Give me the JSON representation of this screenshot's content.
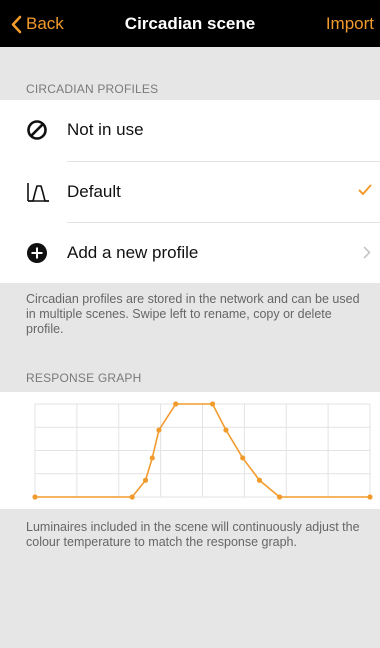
{
  "navbar": {
    "back_label": "Back",
    "title": "Circadian scene",
    "import_label": "Import",
    "accent": "#f29b2d"
  },
  "profiles": {
    "header": "CIRCADIAN PROFILES",
    "items": [
      {
        "label": "Not in use",
        "icon": "not-in-use-icon",
        "selected": false
      },
      {
        "label": "Default",
        "icon": "curve-icon",
        "selected": true
      },
      {
        "label": "Add a new profile",
        "icon": "plus-circle-icon",
        "selected": false
      }
    ],
    "footnote": "Circadian profiles are stored in the network and can be used in multiple scenes. Swipe left to rename, copy or delete profile."
  },
  "graph": {
    "header": "RESPONSE GRAPH",
    "footnote": "Luminaires included in the scene will continuously adjust the colour temperature to match the response graph.",
    "line_color": "#f29b2d",
    "grid_color": "#e3e3e3",
    "x_range": [
      0,
      1
    ],
    "y_range": [
      0,
      1
    ],
    "points": [
      [
        0.0,
        0.0
      ],
      [
        0.29,
        0.0
      ],
      [
        0.33,
        0.18
      ],
      [
        0.35,
        0.42
      ],
      [
        0.37,
        0.72
      ],
      [
        0.42,
        1.0
      ],
      [
        0.53,
        1.0
      ],
      [
        0.57,
        0.72
      ],
      [
        0.62,
        0.42
      ],
      [
        0.67,
        0.18
      ],
      [
        0.73,
        0.0
      ],
      [
        1.0,
        0.0
      ]
    ]
  }
}
